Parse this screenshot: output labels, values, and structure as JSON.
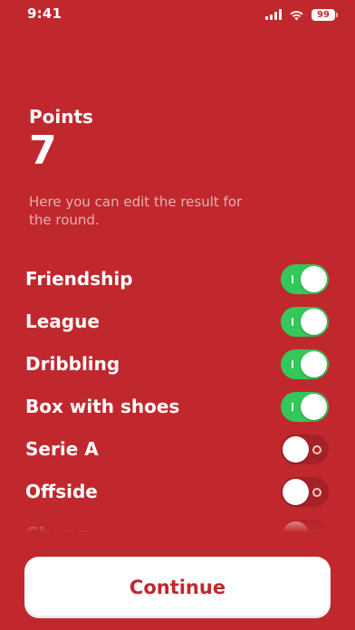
{
  "status_bar": {
    "time": "9:41",
    "battery_level": "99",
    "icons": [
      "cellular-signal-icon",
      "wifi-icon",
      "battery-icon"
    ]
  },
  "points": {
    "title": "Points",
    "value": "7",
    "description": "Here you can edit the result for the round."
  },
  "toggles": [
    {
      "label": "Friendship",
      "on": true
    },
    {
      "label": "League",
      "on": true
    },
    {
      "label": "Dribbling",
      "on": true
    },
    {
      "label": "Box with shoes",
      "on": true
    },
    {
      "label": "Serie A",
      "on": false
    },
    {
      "label": "Offside",
      "on": false
    },
    {
      "label": "Change",
      "on": false
    }
  ],
  "continue_button": {
    "label": "Continue"
  },
  "colors": {
    "background": "#c0282e",
    "toggle_on": "#34c759",
    "toggle_off": "#a42227",
    "button_bg": "#ffffff",
    "button_text": "#c0282e"
  }
}
